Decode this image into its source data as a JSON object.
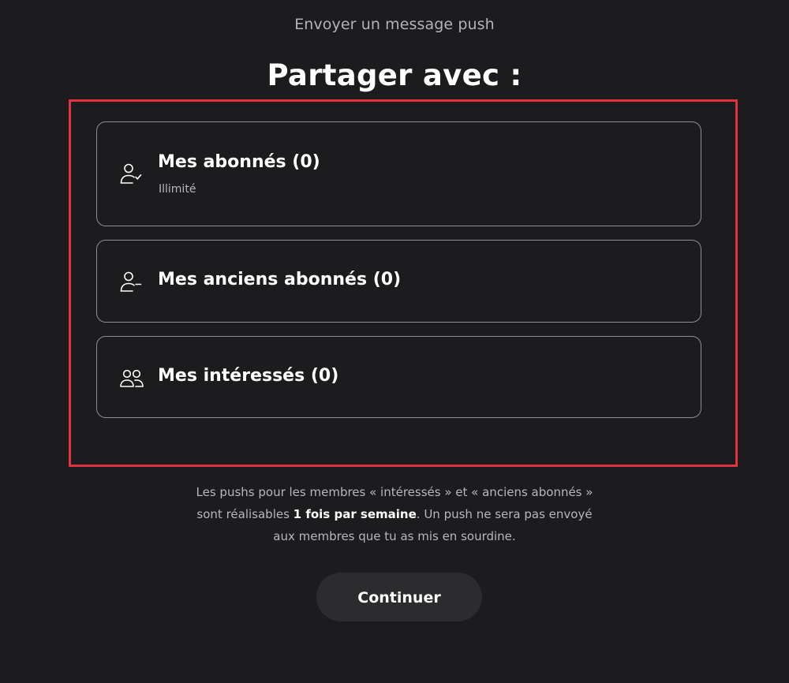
{
  "header": {
    "caption": "Envoyer un message push",
    "title": "Partager avec :"
  },
  "options": [
    {
      "label": "Mes abonnés (0)",
      "sublabel": "Illimité",
      "icon": "user-check-icon"
    },
    {
      "label": "Mes anciens abonnés (0)",
      "icon": "user-minus-icon"
    },
    {
      "label": "Mes intéressés (0)",
      "icon": "users-icon"
    }
  ],
  "footnote": {
    "part1": "Les pushs pour les membres « intéressés » et « anciens abonnés » sont réalisables ",
    "bold": "1 fois par semaine",
    "part2": ". Un push ne sera pas envoyé aux membres que tu as mis en sourdine."
  },
  "actions": {
    "continue_label": "Continuer"
  },
  "colors": {
    "background": "#1c1c1e",
    "highlight": "#e2313f",
    "button": "#2c2c2e"
  }
}
